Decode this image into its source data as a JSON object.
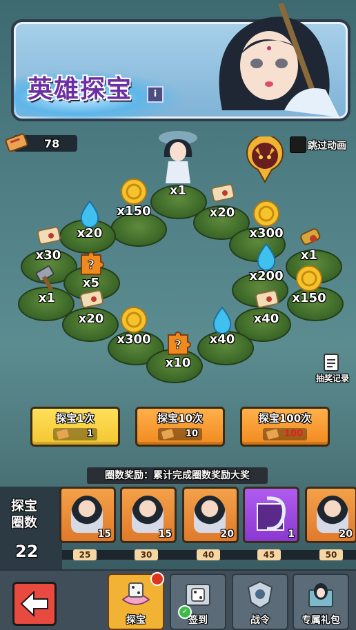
{
  "banner": {
    "title": "英雄探宝",
    "info_icon": "i"
  },
  "tickets": {
    "count": "78"
  },
  "skip_animation": {
    "label": "跳过动画"
  },
  "board": {
    "rewards": [
      {
        "icon": "hero-figurine",
        "amount": "x1"
      },
      {
        "icon": "gold-coin",
        "amount": "x150"
      },
      {
        "icon": "scroll",
        "amount": "x20"
      },
      {
        "icon": "water-drop",
        "amount": "x20"
      },
      {
        "icon": "gold-coin",
        "amount": "x300"
      },
      {
        "icon": "scroll",
        "amount": "x30"
      },
      {
        "icon": "golden-tool",
        "amount": "x1"
      },
      {
        "icon": "mystery-puzzle",
        "amount": "x5"
      },
      {
        "icon": "water-drop",
        "amount": "x200"
      },
      {
        "icon": "hammer",
        "amount": "x1"
      },
      {
        "icon": "gold-coin",
        "amount": "x150"
      },
      {
        "icon": "scroll",
        "amount": "x20"
      },
      {
        "icon": "scroll",
        "amount": "x40"
      },
      {
        "icon": "gold-coin",
        "amount": "x300"
      },
      {
        "icon": "water-drop",
        "amount": "x40"
      },
      {
        "icon": "mystery-puzzle",
        "amount": "x10"
      }
    ]
  },
  "draw_record": {
    "label": "抽奖记录"
  },
  "draw_buttons": [
    {
      "label": "探宝1次",
      "cost": "1",
      "cost_color": "#ffffff"
    },
    {
      "label": "探宝10次",
      "cost": "10",
      "cost_color": "#ffffff"
    },
    {
      "label": "探宝100次",
      "cost": "100",
      "cost_color": "#e02020"
    }
  ],
  "lap_rewards": {
    "banner": "圈数奖励：累计完成圈数奖励大奖",
    "label": "探宝圈数",
    "count": "22",
    "cards": [
      {
        "icon": "hero-fragment",
        "qty": "15",
        "milestone": "25"
      },
      {
        "icon": "hero-fragment",
        "qty": "15",
        "milestone": "30"
      },
      {
        "icon": "hero-fragment",
        "qty": "20",
        "milestone": "40"
      },
      {
        "icon": "purple-frame",
        "qty": "1",
        "milestone": "45"
      },
      {
        "icon": "hero-fragment",
        "qty": "20",
        "milestone": "50"
      }
    ]
  },
  "nav": {
    "back": "back-arrow",
    "items": [
      {
        "label": "探宝",
        "icon": "lotus-dice-icon",
        "active": true,
        "badge": "red-dot"
      },
      {
        "label": "签到",
        "icon": "dice-box-icon",
        "active": false,
        "badge": "check"
      },
      {
        "label": "战令",
        "icon": "crest-icon",
        "active": false
      },
      {
        "label": "专属礼包",
        "icon": "gift-hero-icon",
        "active": false
      }
    ]
  },
  "colors": {
    "accent": "#f2b233",
    "button_orange": "#f08a1f",
    "button_yellow": "#f4c531",
    "back_red": "#e84a3f"
  }
}
